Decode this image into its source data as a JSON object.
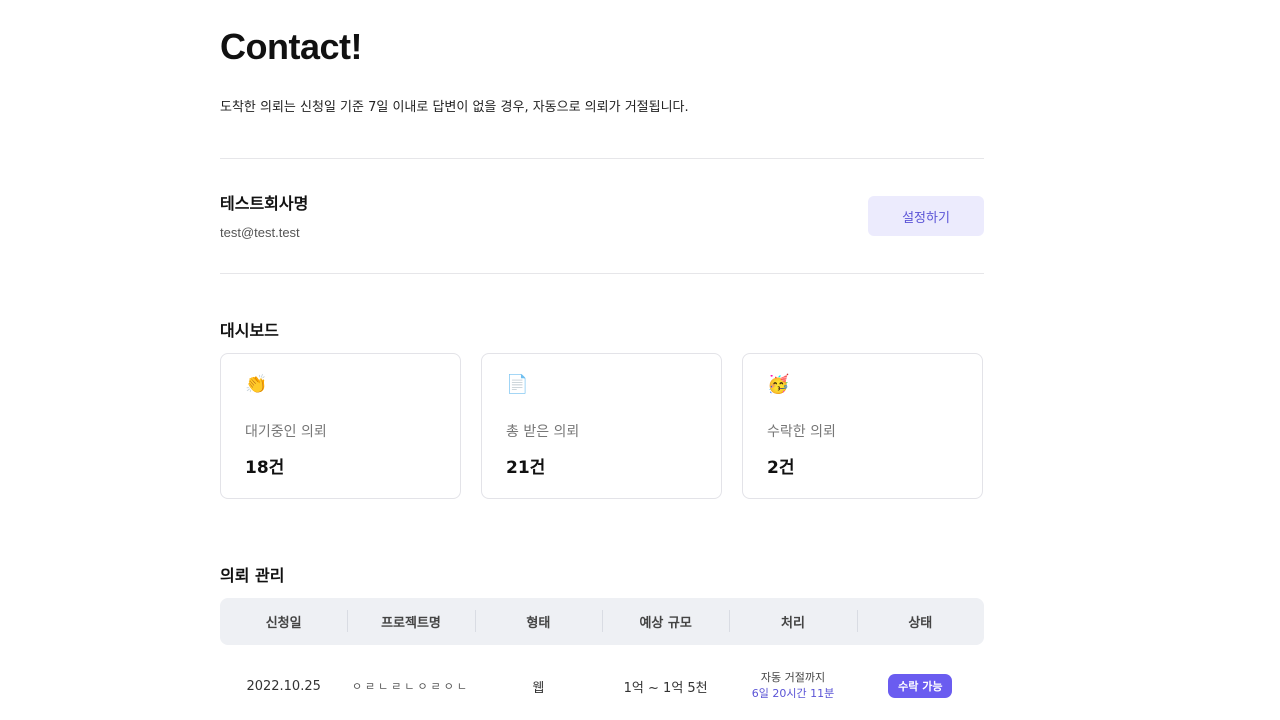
{
  "header": {
    "title": "Contact!",
    "subtitle": "도착한 의뢰는 신청일 기준 7일 이내로 답변이 없을 경우, 자동으로 의뢰가 거절됩니다."
  },
  "profile": {
    "company": "테스트회사명",
    "email": "test@test.test",
    "settings_label": "설정하기"
  },
  "dashboard": {
    "title": "대시보드",
    "cards": [
      {
        "icon": "waving-hands-icon",
        "emoji": "👏",
        "label": "대기중인 의뢰",
        "value": "18건"
      },
      {
        "icon": "document-icon",
        "emoji": "📄",
        "label": "총 받은 의뢰",
        "value": "21건"
      },
      {
        "icon": "celebration-face-icon",
        "emoji": "🥳",
        "label": "수락한 의뢰",
        "value": "2건"
      }
    ]
  },
  "requests": {
    "title": "의뢰 관리",
    "columns": [
      "신청일",
      "프로젝트명",
      "형태",
      "예상 규모",
      "처리",
      "상태"
    ],
    "rows": [
      {
        "date": "2022.10.25",
        "project": "ㅇㄹㄴㄹㄴㅇㄹㅇㄴ",
        "type": "웹",
        "budget": "1억 ~ 1억 5천",
        "process_top": "자동 거절까지",
        "process_bottom": "6일 20시간 11분",
        "status": "수락 가능"
      }
    ]
  },
  "colors": {
    "accent": "#6a5cf0",
    "accent_light": "#ecebfd",
    "table_header": "#eef0f4"
  }
}
